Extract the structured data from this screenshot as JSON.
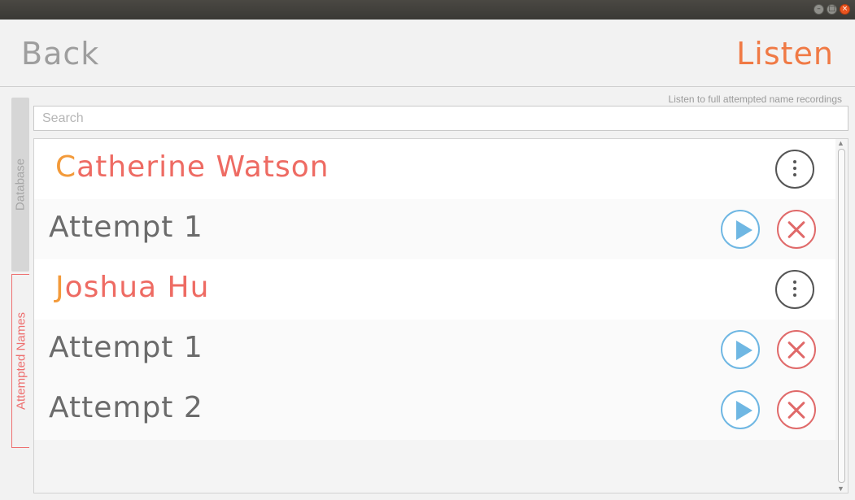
{
  "window": {
    "controls": {
      "minimize": "–",
      "maximize": "□",
      "close": "×"
    }
  },
  "header": {
    "back_label": "Back",
    "title": "Listen",
    "accent_color": "#f07a45"
  },
  "sidebar": {
    "tabs": [
      {
        "label": "Database",
        "active": false
      },
      {
        "label": "Attempted Names",
        "active": true
      }
    ]
  },
  "hint_text": "Listen to full attempted name recordings",
  "search": {
    "placeholder": "Search",
    "value": ""
  },
  "entries": [
    {
      "name": "Catherine Watson",
      "attempts": [
        {
          "label": "Attempt 1"
        }
      ]
    },
    {
      "name": "Joshua Hu",
      "attempts": [
        {
          "label": "Attempt 1"
        },
        {
          "label": "Attempt 2"
        }
      ]
    }
  ],
  "icons": {
    "more": "more-vertical-icon",
    "play": "play-icon",
    "delete": "delete-x-icon"
  }
}
